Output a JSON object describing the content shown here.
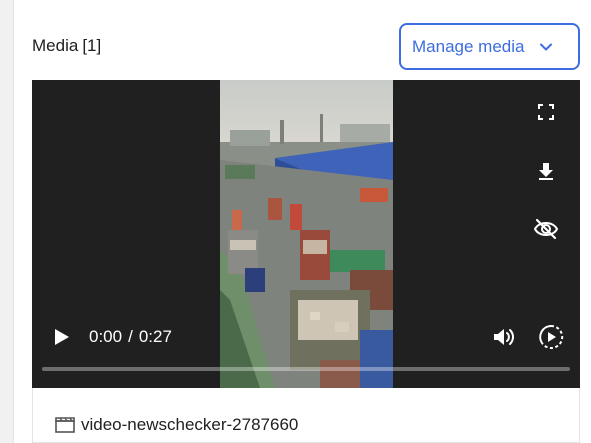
{
  "media": {
    "title": "Media",
    "count": "[1]",
    "manage_label": "Manage media"
  },
  "player": {
    "current_time": "0:00",
    "separator": "/",
    "duration": "0:27",
    "progress_fraction": 0.0
  },
  "file": {
    "name": "video-newschecker-2787660",
    "icon": "clapperboard-icon"
  },
  "icons": {
    "fullscreen": "fullscreen-icon",
    "download": "download-icon",
    "hide": "eye-off-icon",
    "play": "play-icon",
    "volume": "volume-icon",
    "speed": "playback-speed-icon",
    "chevron": "chevron-down-icon"
  },
  "colors": {
    "accent": "#3d6de0",
    "player_bg": "#202020"
  }
}
